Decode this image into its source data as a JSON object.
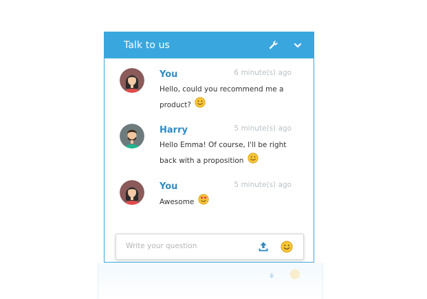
{
  "header": {
    "title": "Talk to us",
    "settings_icon": "wrench-icon",
    "collapse_icon": "chevron-down-icon",
    "color": "#3aa6de"
  },
  "messages": [
    {
      "author": "You",
      "time": "6 minute(s) ago",
      "text": "Hello, could you recommend me a product?",
      "emoji": "smile-emoji"
    },
    {
      "author": "Harry",
      "time": "5 minute(s) ago",
      "text": "Hello Emma! Of course, I'll be right back with a proposition",
      "emoji": "smile-emoji"
    },
    {
      "author": "You",
      "time": "5 minute(s) ago",
      "text": "Awesome",
      "emoji": "heart-eyes-emoji"
    }
  ],
  "composer": {
    "placeholder": "Write your question",
    "upload_icon": "upload-icon",
    "emoji_icon": "smiley-icon"
  }
}
